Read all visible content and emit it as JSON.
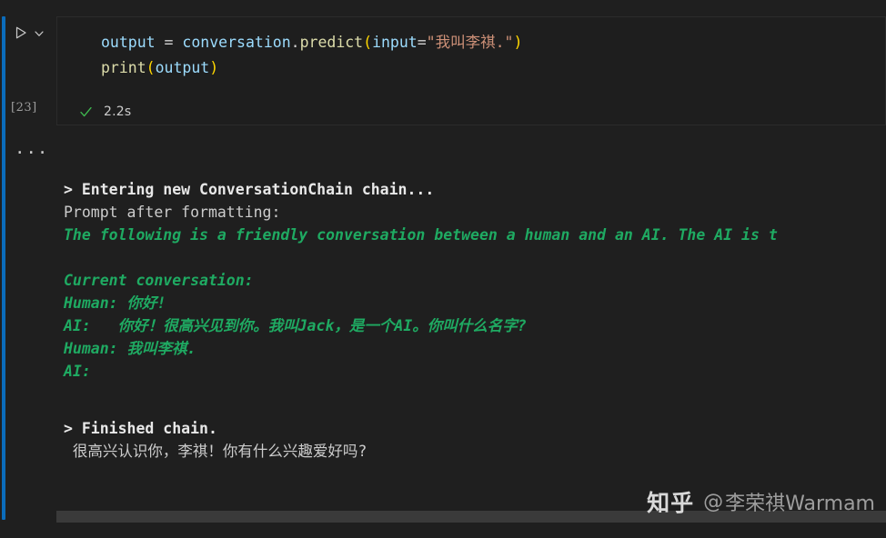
{
  "gutter": {
    "run_icon": "play-icon",
    "chevron_icon": "chevron-down-icon",
    "execution_count": "[23]",
    "more_label": "..."
  },
  "code_cell": {
    "line1": {
      "var_output": "output",
      "eq": " = ",
      "conversation": "conversation",
      "dot": ".",
      "predict": "predict",
      "open_paren": "(",
      "input_kw": "input",
      "equals": "=",
      "string": "\"我叫李祺.\"",
      "close_paren": ")"
    },
    "line2": {
      "print": "print",
      "open_paren": "(",
      "arg": "output",
      "close_paren": ")"
    }
  },
  "status": {
    "check_icon": "check-icon",
    "duration": "2.2s"
  },
  "output": {
    "lines": [
      {
        "type": "bold",
        "text": "> Entering new ConversationChain chain..."
      },
      {
        "type": "plain",
        "text": "Prompt after formatting:"
      },
      {
        "type": "green",
        "text": "The following is a friendly conversation between a human and an AI. The AI is t"
      },
      {
        "type": "blank",
        "text": ""
      },
      {
        "type": "green",
        "text": "Current conversation:"
      },
      {
        "type": "green",
        "text": "Human: 你好!"
      },
      {
        "type": "green",
        "text": "AI:   你好！很高兴见到你。我叫Jack，是一个AI。你叫什么名字?"
      },
      {
        "type": "green",
        "text": "Human: 我叫李祺."
      },
      {
        "type": "green",
        "text": "AI:"
      },
      {
        "type": "blank",
        "text": ""
      },
      {
        "type": "bold",
        "text": "> Finished chain."
      },
      {
        "type": "plain",
        "text": " 很高兴认识你，李祺！你有什么兴趣爱好吗?"
      }
    ]
  },
  "scrollbar": {
    "name": "horizontal-scrollbar"
  },
  "watermark": {
    "logo": "知乎",
    "at": "@",
    "handle": "李荣祺Warmam"
  },
  "colors": {
    "background": "#1f1f1f",
    "cell_background": "#1e1e1e",
    "accent_blue": "#0b6cbb",
    "green_text": "#1faa62",
    "string_orange": "#ce9178",
    "variable_blue": "#9cdcfe",
    "function_yellow": "#dcdcaa",
    "paren_gold": "#ffd700",
    "check_green": "#3fb950"
  }
}
